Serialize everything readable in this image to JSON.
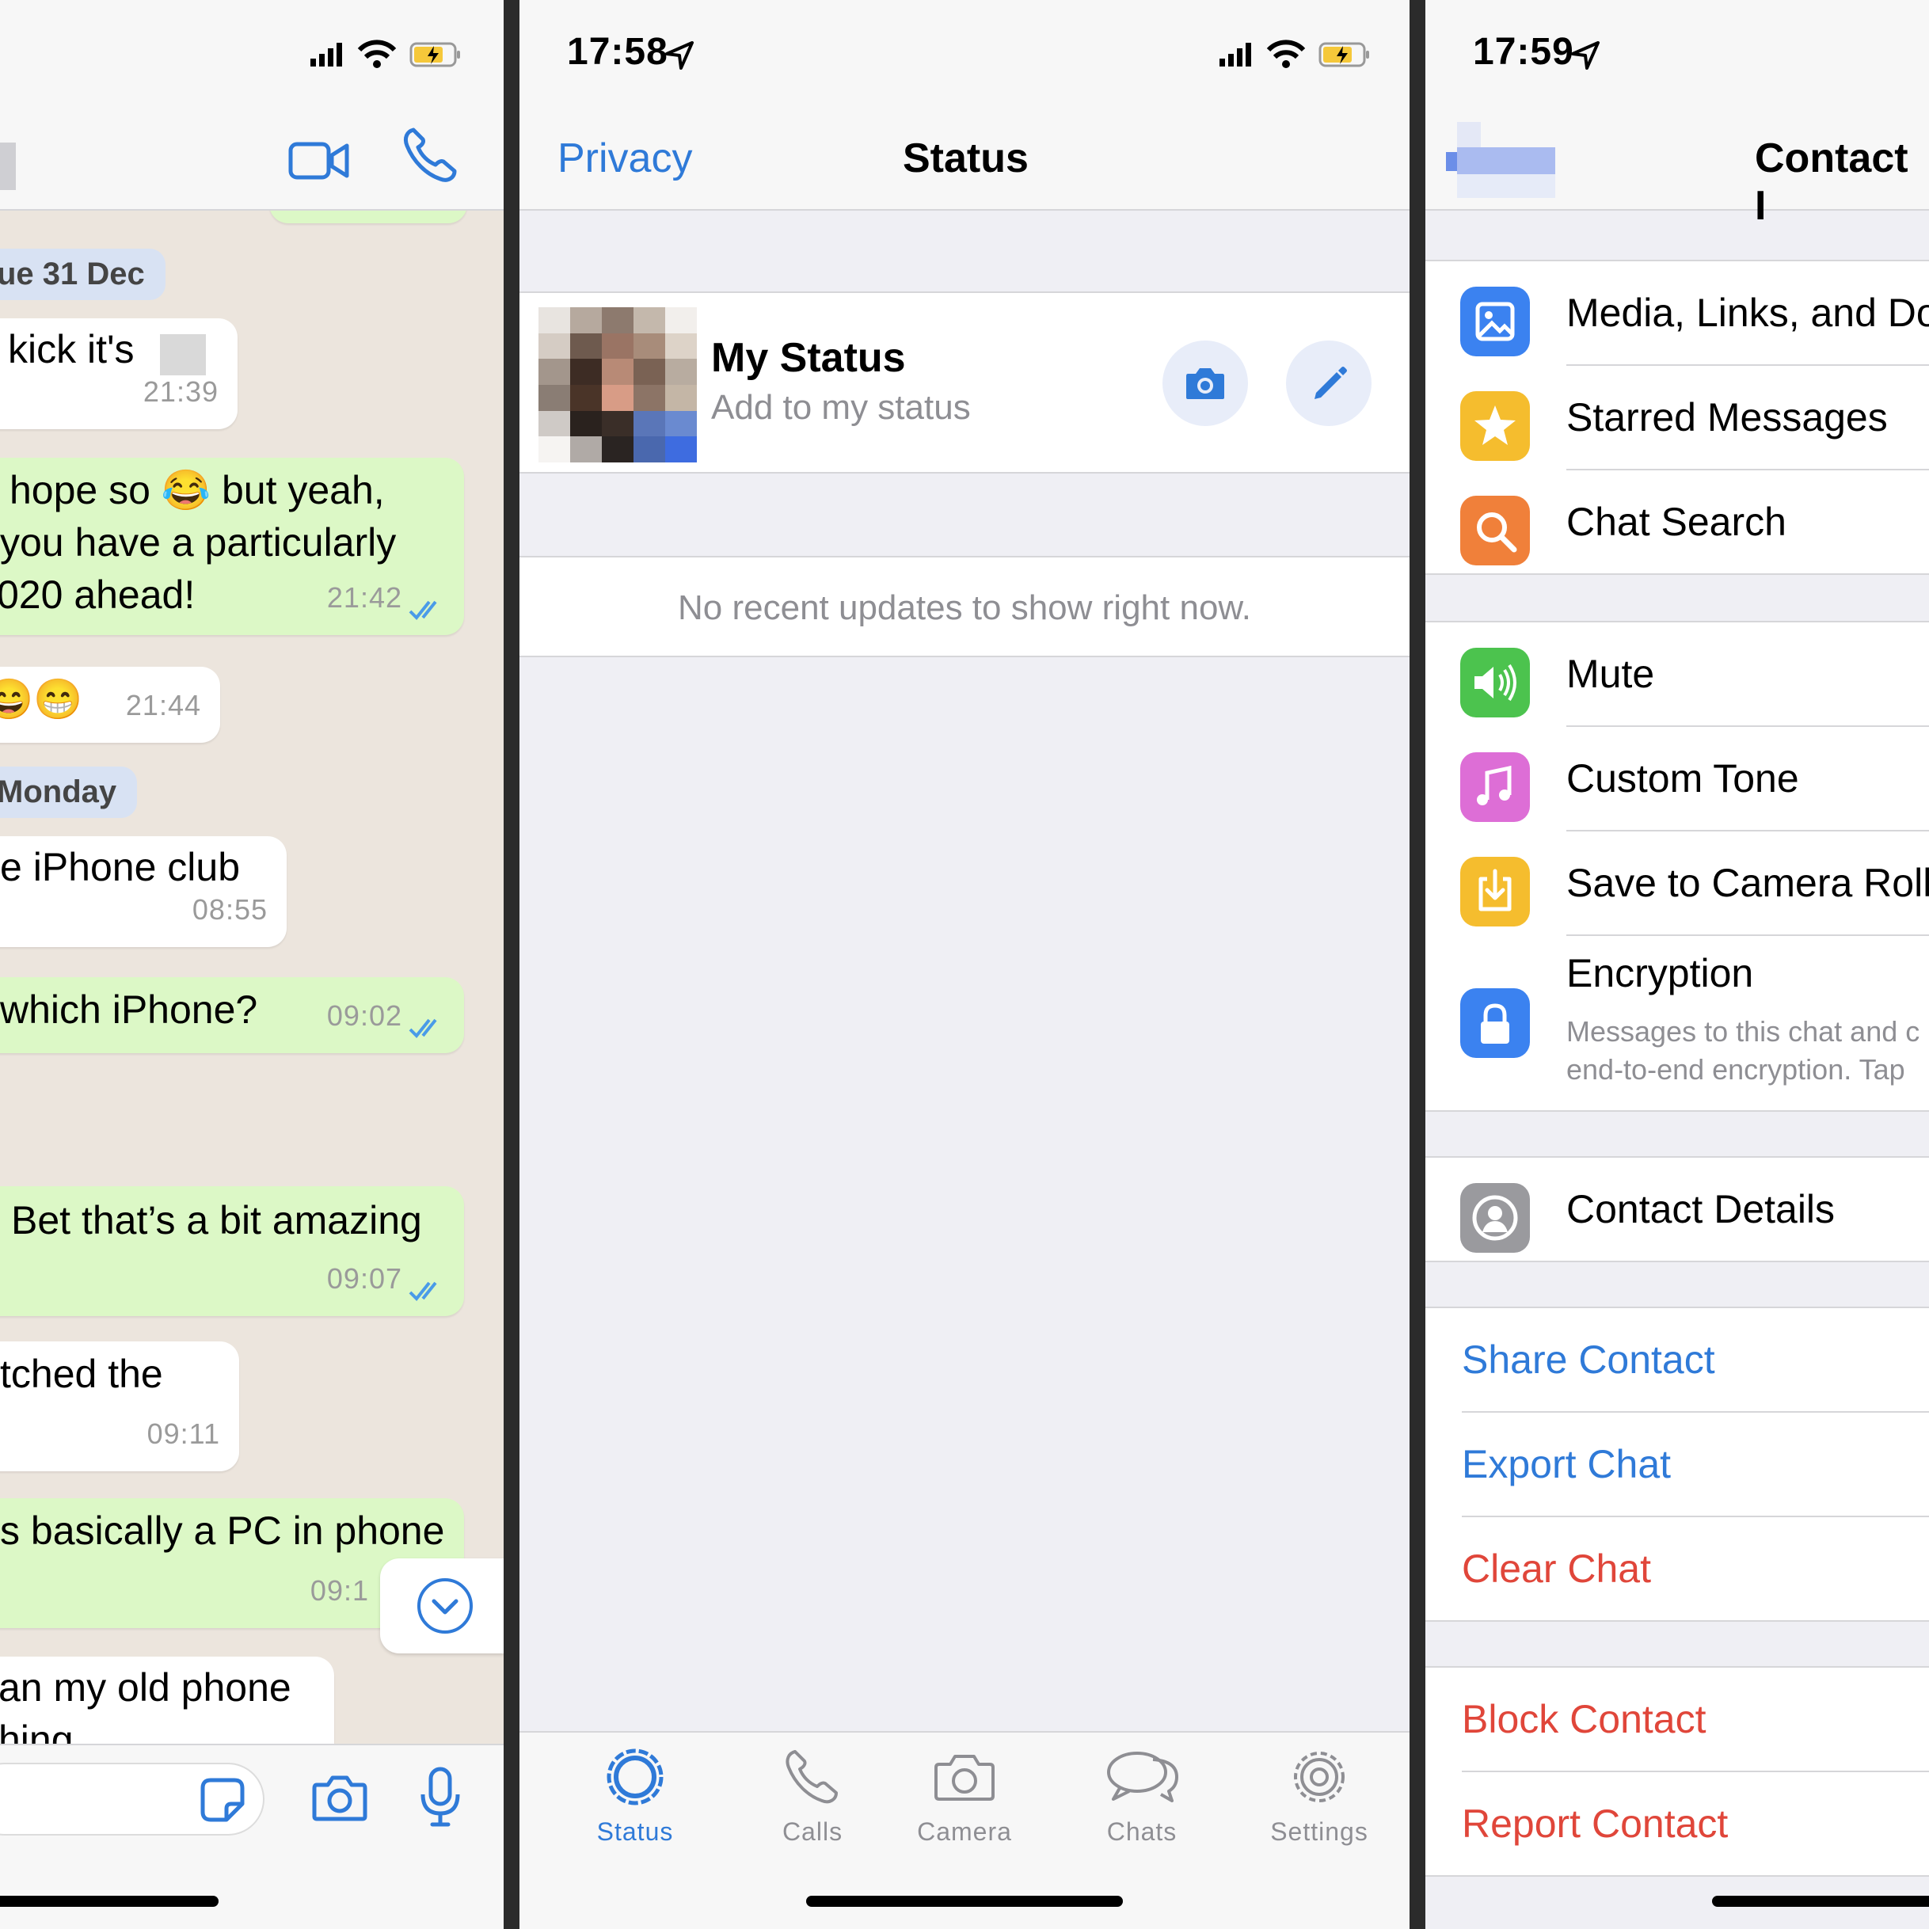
{
  "left_panel": {
    "status_bar": {
      "icons": [
        "signal-icon",
        "wifi-icon",
        "battery-charging-icon"
      ]
    },
    "header": {
      "icons": [
        "video-call-icon",
        "phone-call-icon"
      ]
    },
    "messages": [
      {
        "kind": "date",
        "text": "ue 31 Dec"
      },
      {
        "kind": "in",
        "lines": [
          "kick it's"
        ],
        "time": "21:39"
      },
      {
        "kind": "out",
        "lines": [
          "hope so 😂 but yeah,",
          "you have a particularly",
          "020 ahead!"
        ],
        "time": "21:42"
      },
      {
        "kind": "in",
        "lines": [
          "😄😁"
        ],
        "time": "21:44"
      },
      {
        "kind": "date",
        "text": "Monday"
      },
      {
        "kind": "in",
        "lines": [
          "e iPhone club"
        ],
        "time": "08:55"
      },
      {
        "kind": "out",
        "lines": [
          "which iPhone?"
        ],
        "time": "09:02"
      },
      {
        "kind": "out",
        "lines": [
          "Bet that’s a bit amazing"
        ],
        "time": "09:07"
      },
      {
        "kind": "in",
        "lines": [
          "tched the"
        ],
        "time": "09:11"
      },
      {
        "kind": "out",
        "lines": [
          "s basically a PC in phone"
        ],
        "time": "09:1"
      },
      {
        "kind": "in",
        "lines": [
          "an my old phone",
          "hing"
        ],
        "time": ""
      }
    ],
    "input_bar": {
      "icons": [
        "sticker-icon",
        "camera-icon",
        "microphone-icon"
      ]
    }
  },
  "middle_panel": {
    "status_bar": {
      "time": "17:58"
    },
    "nav": {
      "back_label": "Privacy",
      "title": "Status"
    },
    "my_status": {
      "title": "My Status",
      "subtitle": "Add to my status"
    },
    "empty_message": "No recent updates to show right now.",
    "tabs": [
      {
        "label": "Status",
        "icon": "status-icon",
        "active": true
      },
      {
        "label": "Calls",
        "icon": "calls-icon",
        "active": false
      },
      {
        "label": "Camera",
        "icon": "camera-icon",
        "active": false
      },
      {
        "label": "Chats",
        "icon": "chats-icon",
        "active": false
      },
      {
        "label": "Settings",
        "icon": "settings-icon",
        "active": false
      }
    ],
    "accent": "#2f7ad8"
  },
  "right_panel": {
    "status_bar": {
      "time": "17:59"
    },
    "nav": {
      "title": "Contact I"
    },
    "group1": [
      {
        "label": "Media, Links, and Do",
        "icon": "photo-icon",
        "color": "#3b82f0"
      },
      {
        "label": "Starred Messages",
        "icon": "star-icon",
        "color": "#f5bd2e"
      },
      {
        "label": "Chat Search",
        "icon": "search-icon",
        "color": "#f0803a"
      }
    ],
    "group2": [
      {
        "label": "Mute",
        "icon": "speaker-icon",
        "color": "#4cc34e"
      },
      {
        "label": "Custom Tone",
        "icon": "music-note-icon",
        "color": "#dd6ed6"
      },
      {
        "label": "Save to Camera Roll",
        "icon": "save-download-icon",
        "color": "#f5bd2e"
      }
    ],
    "encryption": {
      "label": "Encryption",
      "sub1": "Messages to this chat and c",
      "sub2": "end-to-end encryption. Tap",
      "icon": "lock-icon",
      "color": "#3b82f0"
    },
    "contact_details": {
      "label": "Contact Details",
      "icon": "contact-icon",
      "color": "#9a9a9e"
    },
    "actions_blue": [
      "Share Contact",
      "Export Chat"
    ],
    "actions_red": [
      "Clear Chat"
    ],
    "actions_red2": [
      "Block Contact",
      "Report Contact"
    ]
  }
}
